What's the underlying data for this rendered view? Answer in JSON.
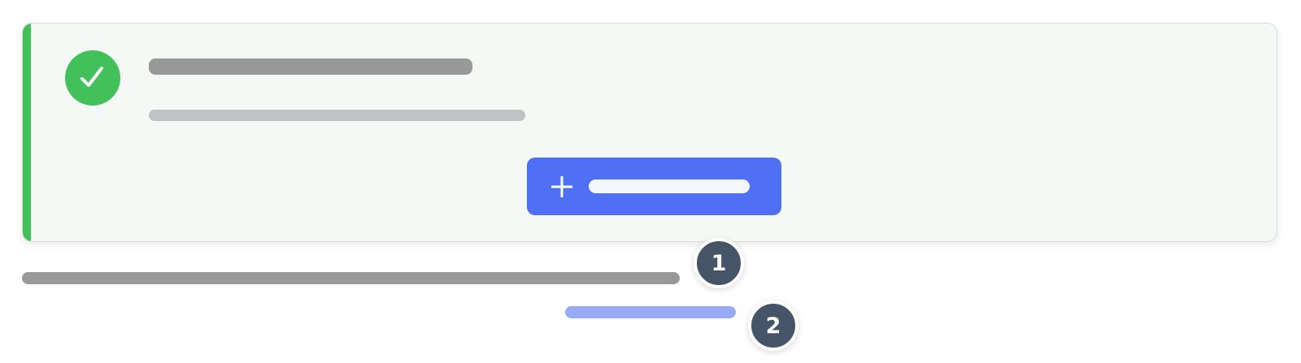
{
  "colors": {
    "success": "#42c059",
    "primary": "#4f70f5",
    "title_placeholder": "#999999",
    "subtitle_placeholder": "#bfc3c6",
    "button_text_placeholder": "#f4f6fb",
    "link_placeholder": "#98acf6",
    "marker": "#465468"
  },
  "card": {
    "status_icon": "check-icon",
    "title": "",
    "subtitle": "",
    "add_button": {
      "icon": "plus-icon",
      "label": ""
    }
  },
  "footer": {
    "text": "",
    "link": ""
  },
  "markers": [
    "1",
    "2"
  ]
}
